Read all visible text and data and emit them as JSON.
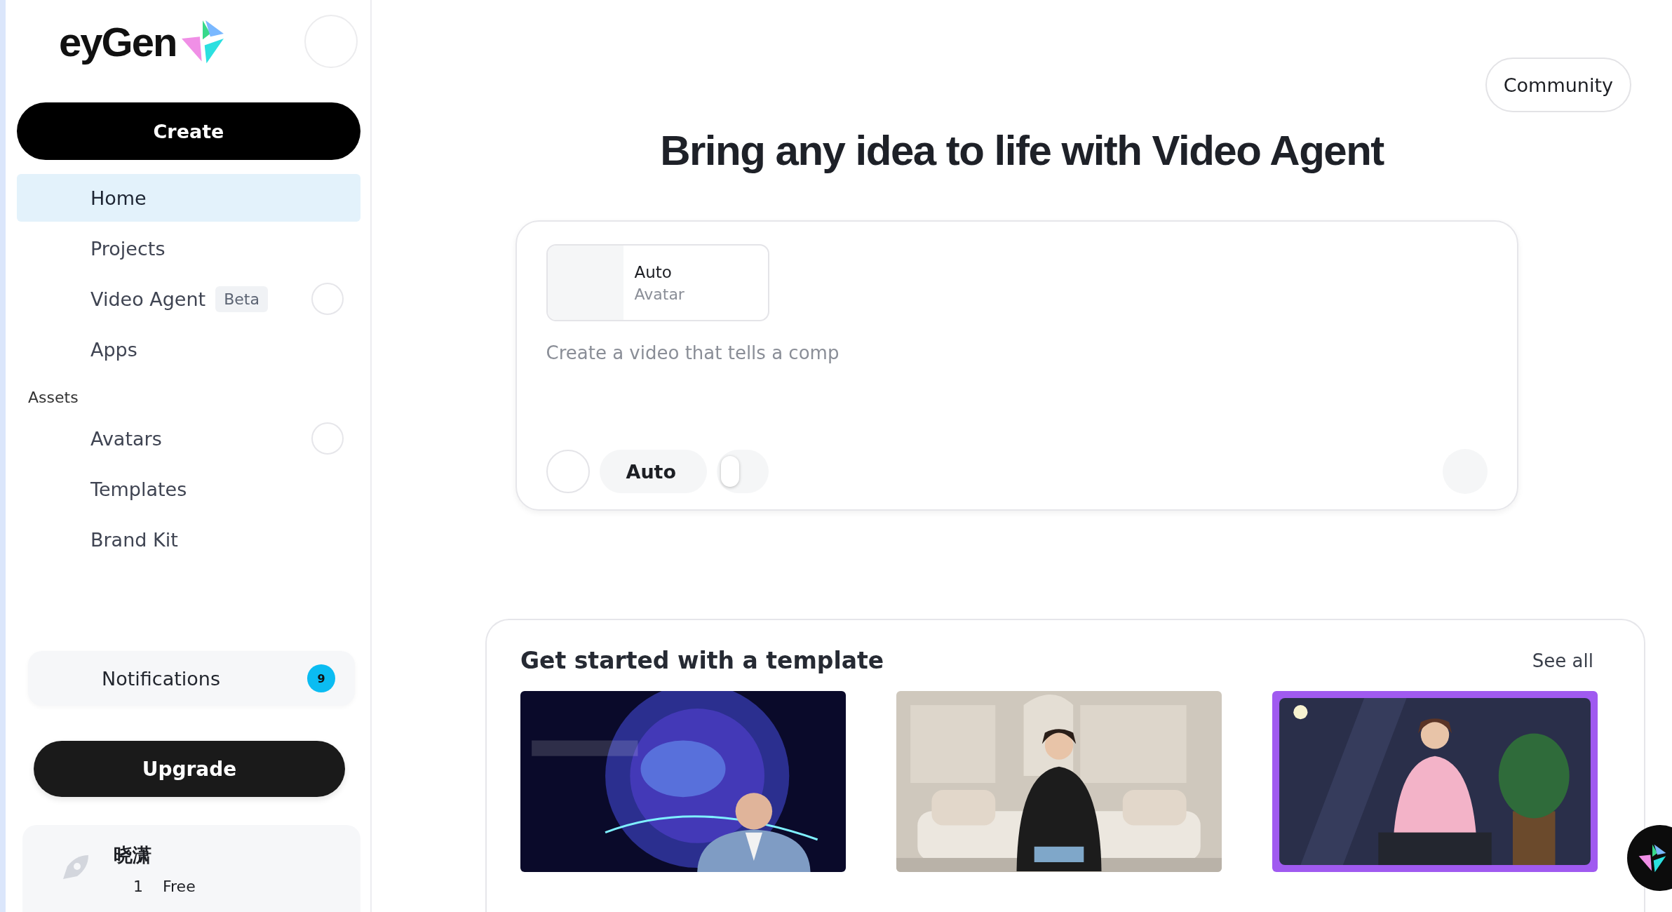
{
  "logo": {
    "text": "eyGen"
  },
  "create_button": "Create",
  "nav": [
    {
      "label": "Home",
      "selected": true
    },
    {
      "label": "Projects",
      "selected": false
    },
    {
      "label": "Video Agent",
      "badge": "Beta",
      "selected": false
    },
    {
      "label": "Apps",
      "selected": false
    }
  ],
  "assets": {
    "heading": "Assets",
    "items": [
      {
        "label": "Avatars",
        "selected": false
      },
      {
        "label": "Templates",
        "selected": false
      },
      {
        "label": "Brand Kit",
        "selected": false
      }
    ]
  },
  "notifications": {
    "label": "Notifications",
    "count": "9"
  },
  "upgrade_button": "Upgrade",
  "user": {
    "name": "晓潇",
    "credits": "1",
    "plan": "Free"
  },
  "community_button": "Community",
  "headline": "Bring any idea to life with Video Agent",
  "prompt": {
    "avatar_title": "Auto",
    "avatar_subtitle": "Avatar",
    "placeholder": "Create a video that tells a comp",
    "mode": "Auto",
    "toggle_on": false
  },
  "templates": {
    "title": "Get started with a template",
    "see_all": "See all",
    "items": [
      {
        "kind": "news"
      },
      {
        "kind": "room"
      },
      {
        "kind": "speaker"
      }
    ]
  }
}
